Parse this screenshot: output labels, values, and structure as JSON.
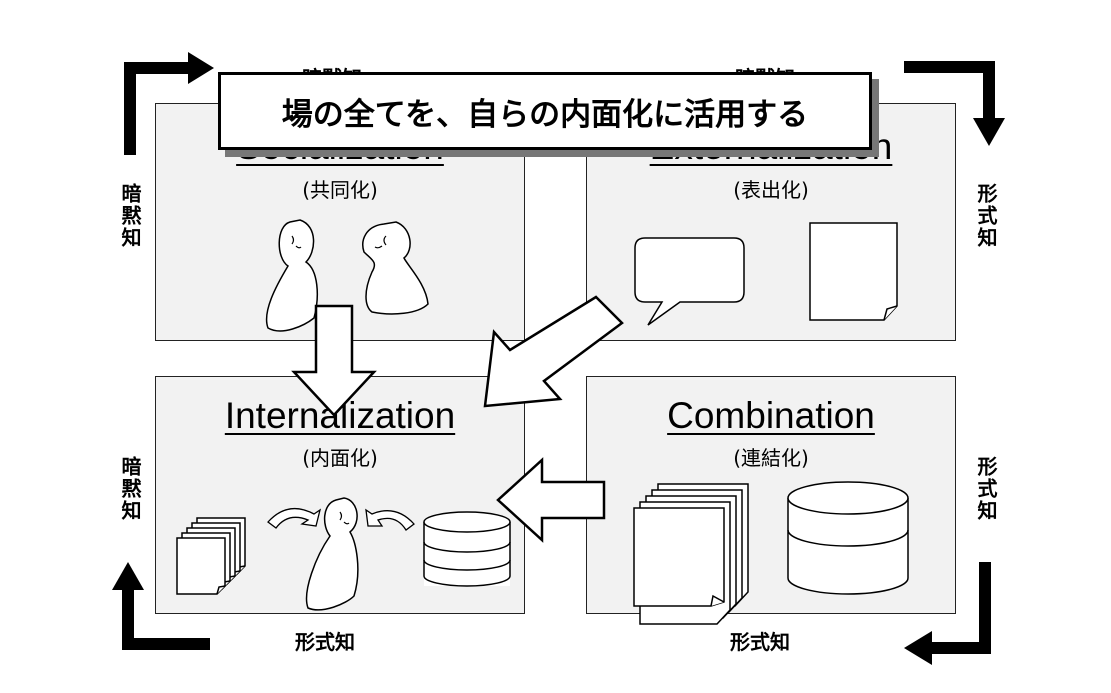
{
  "banner": {
    "text": "場の全てを、自らの内面化に活用する"
  },
  "quadrants": {
    "socialization": {
      "title": "Socialization",
      "subtitle": "(共同化)"
    },
    "externalization": {
      "title": "Externalization",
      "subtitle": "(表出化)"
    },
    "internalization": {
      "title": "Internalization",
      "subtitle": "(内面化)"
    },
    "combination": {
      "title": "Combination",
      "subtitle": "(連結化)"
    }
  },
  "edge_labels": {
    "top_left": "暗黙知",
    "top_right": "暗黙知",
    "left_top": "暗黙知",
    "left_bottom": "暗黙知",
    "right_top": "形式知",
    "right_bottom": "形式知",
    "bottom_left": "形式知",
    "bottom_right": "形式知"
  },
  "colors": {
    "panel": "#f2f2f2",
    "stroke": "#000000",
    "shadow": "#777777"
  },
  "icons": [
    "person-icon",
    "speech-bubble-icon",
    "document-icon",
    "document-stack-icon",
    "database-icon",
    "curved-arrow-icon",
    "block-arrow-icon",
    "corner-arrow-icon"
  ]
}
